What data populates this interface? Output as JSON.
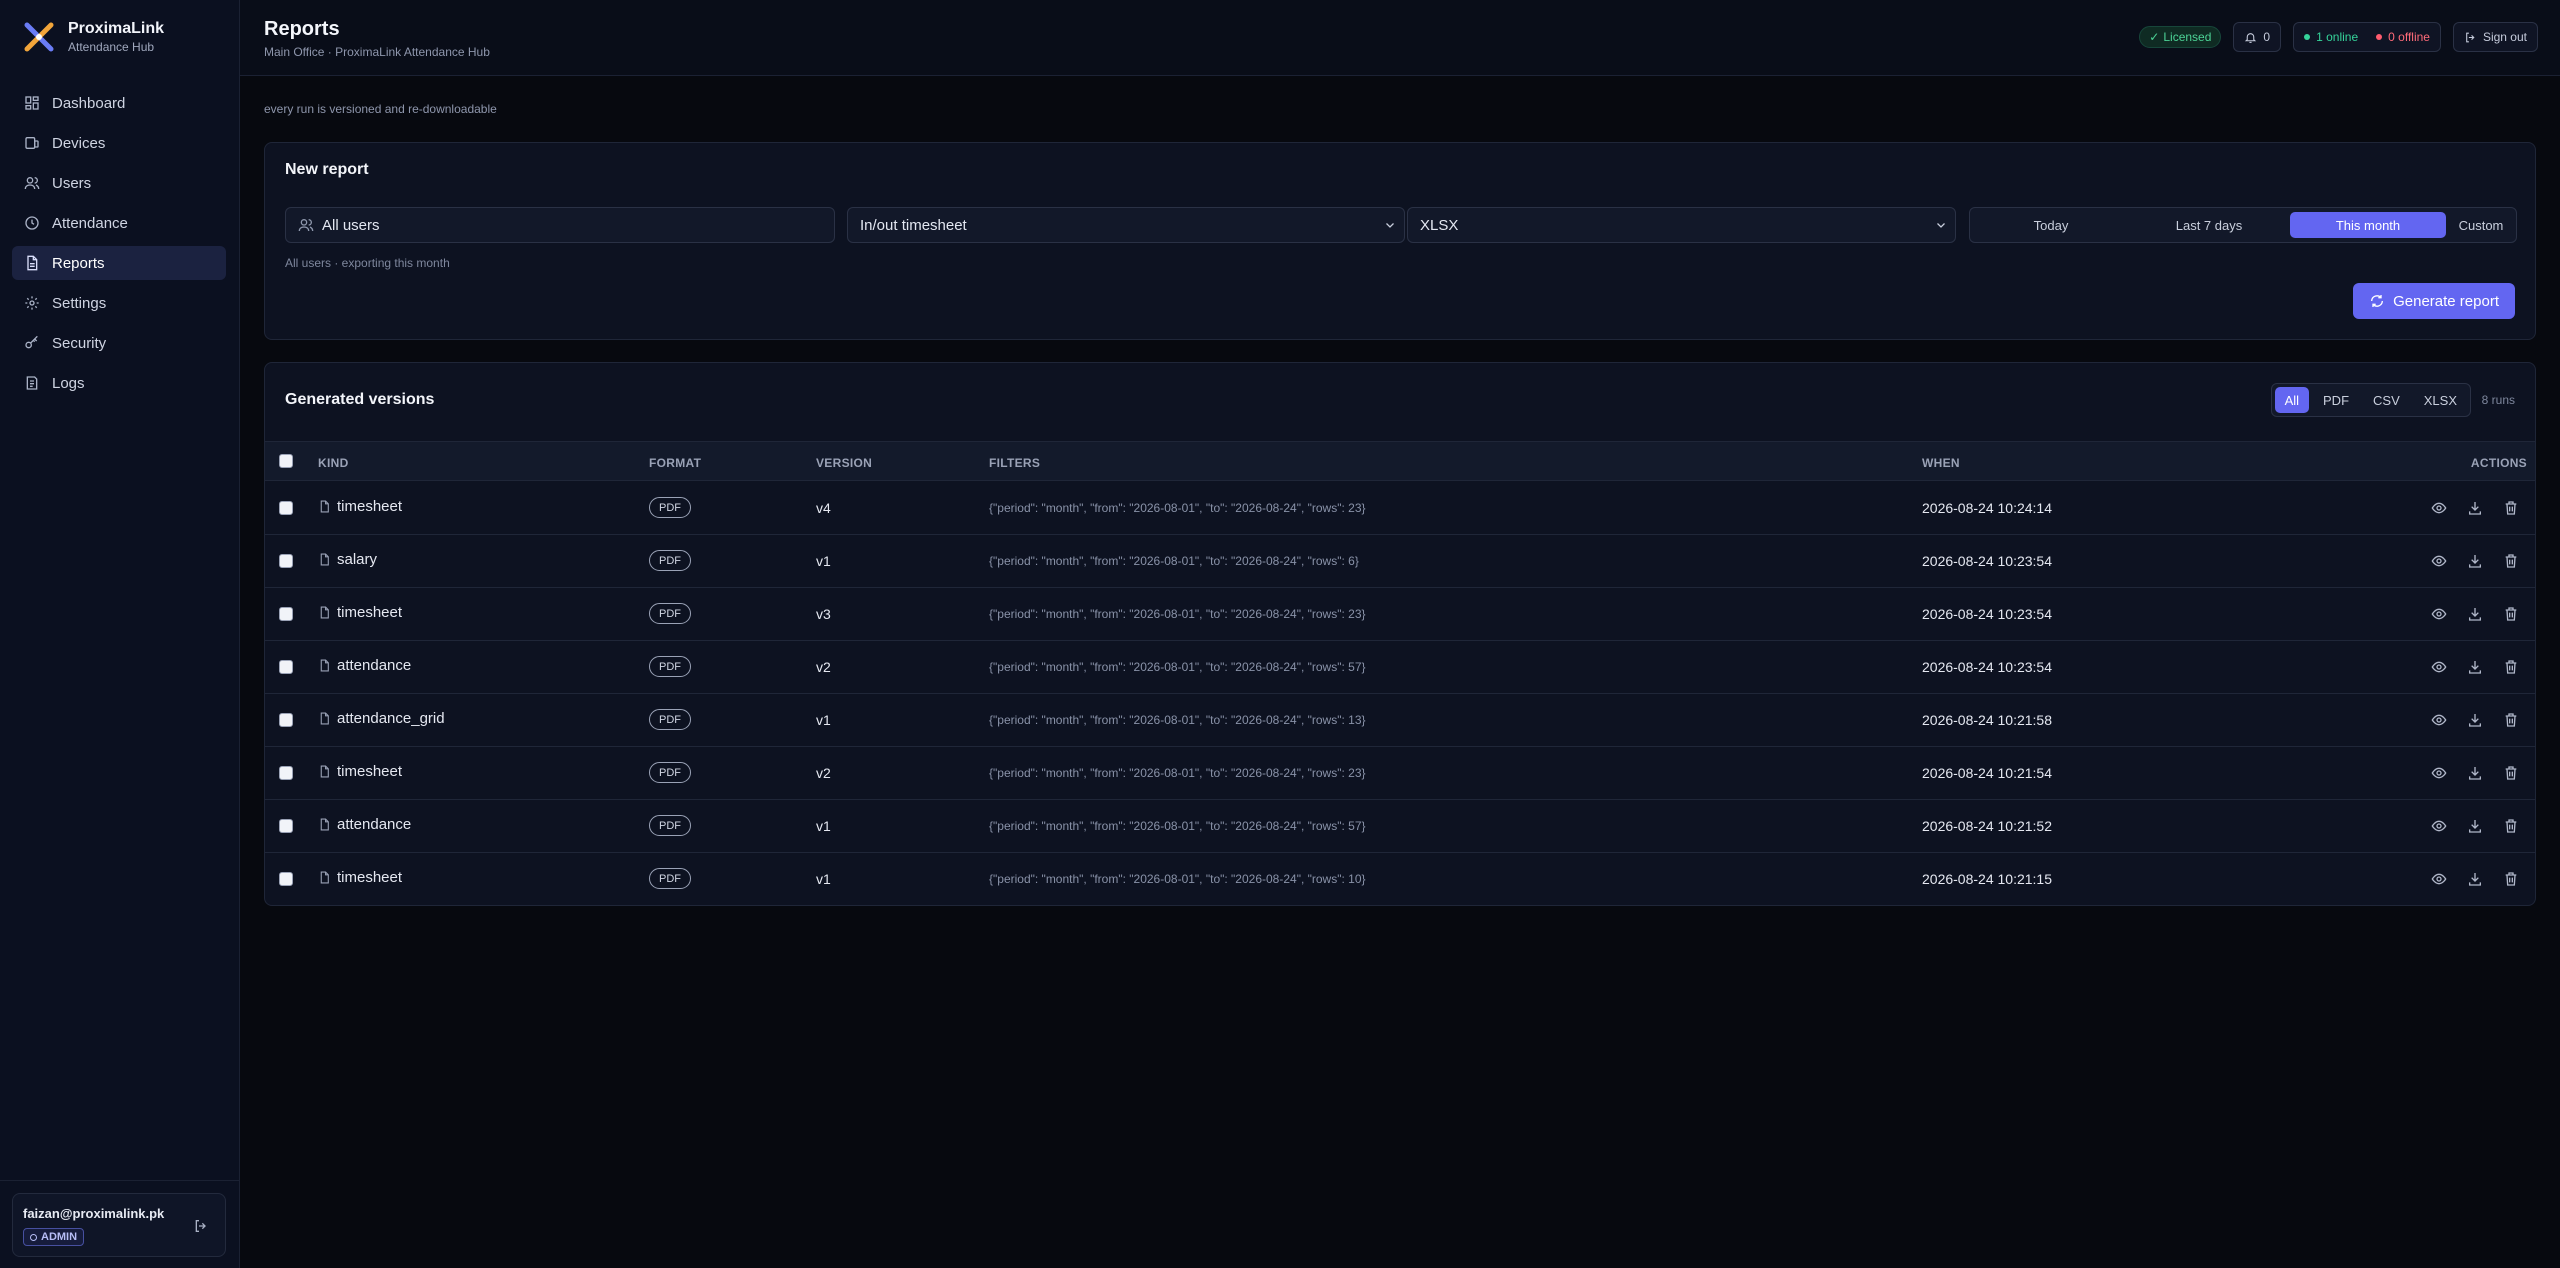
{
  "brand": {
    "name": "ProximaLink",
    "subtitle": "Attendance Hub"
  },
  "sidebar": {
    "items": [
      {
        "label": "Dashboard",
        "icon": "dashboard-icon"
      },
      {
        "label": "Devices",
        "icon": "devices-icon"
      },
      {
        "label": "Users",
        "icon": "users-icon"
      },
      {
        "label": "Attendance",
        "icon": "clock-icon"
      },
      {
        "label": "Reports",
        "icon": "report-icon",
        "active": true
      },
      {
        "label": "Settings",
        "icon": "gear-icon"
      },
      {
        "label": "Security",
        "icon": "key-icon"
      },
      {
        "label": "Logs",
        "icon": "logs-icon"
      }
    ],
    "user": {
      "email": "faizan@proximalink.pk",
      "role": "ADMIN"
    }
  },
  "header": {
    "title": "Reports",
    "subtitle": "Main Office · ProximaLink Attendance Hub",
    "licensed": "Licensed",
    "notifications": "0",
    "online": "1 online",
    "offline": "0 offline",
    "sign_out": "Sign out"
  },
  "main": {
    "note": "every run is versioned and re-downloadable",
    "new_report": {
      "title": "New report",
      "users_value": "All users",
      "report_type": "In/out timesheet",
      "format": "XLSX",
      "ranges": [
        "Today",
        "Last 7 days",
        "This month",
        "Custom"
      ],
      "active_range": "This month",
      "hint": "All users · exporting this month",
      "generate_label": "Generate report"
    },
    "versions": {
      "title": "Generated versions",
      "filters": [
        "All",
        "PDF",
        "CSV",
        "XLSX"
      ],
      "active_filter": "All",
      "runs": "8 runs",
      "columns": {
        "kind": "KIND",
        "format": "FORMAT",
        "version": "VERSION",
        "filters": "FILTERS",
        "when": "WHEN",
        "actions": "ACTIONS"
      },
      "rows": [
        {
          "kind": "timesheet",
          "format": "PDF",
          "version": "v4",
          "filters": "{\"period\": \"month\", \"from\": \"2026-08-01\", \"to\": \"2026-08-24\", \"rows\": 23}",
          "when": "2026-08-24 10:24:14"
        },
        {
          "kind": "salary",
          "format": "PDF",
          "version": "v1",
          "filters": "{\"period\": \"month\", \"from\": \"2026-08-01\", \"to\": \"2026-08-24\", \"rows\": 6}",
          "when": "2026-08-24 10:23:54"
        },
        {
          "kind": "timesheet",
          "format": "PDF",
          "version": "v3",
          "filters": "{\"period\": \"month\", \"from\": \"2026-08-01\", \"to\": \"2026-08-24\", \"rows\": 23}",
          "when": "2026-08-24 10:23:54"
        },
        {
          "kind": "attendance",
          "format": "PDF",
          "version": "v2",
          "filters": "{\"period\": \"month\", \"from\": \"2026-08-01\", \"to\": \"2026-08-24\", \"rows\": 57}",
          "when": "2026-08-24 10:23:54"
        },
        {
          "kind": "attendance_grid",
          "format": "PDF",
          "version": "v1",
          "filters": "{\"period\": \"month\", \"from\": \"2026-08-01\", \"to\": \"2026-08-24\", \"rows\": 13}",
          "when": "2026-08-24 10:21:58"
        },
        {
          "kind": "timesheet",
          "format": "PDF",
          "version": "v2",
          "filters": "{\"period\": \"month\", \"from\": \"2026-08-01\", \"to\": \"2026-08-24\", \"rows\": 23}",
          "when": "2026-08-24 10:21:54"
        },
        {
          "kind": "attendance",
          "format": "PDF",
          "version": "v1",
          "filters": "{\"period\": \"month\", \"from\": \"2026-08-01\", \"to\": \"2026-08-24\", \"rows\": 57}",
          "when": "2026-08-24 10:21:52"
        },
        {
          "kind": "timesheet",
          "format": "PDF",
          "version": "v1",
          "filters": "{\"period\": \"month\", \"from\": \"2026-08-01\", \"to\": \"2026-08-24\", \"rows\": 10}",
          "when": "2026-08-24 10:21:15"
        }
      ]
    }
  },
  "colors": {
    "accent": "#6366f1",
    "background": "#07090f",
    "sidebar": "#0b1020",
    "success": "#35d39a",
    "danger": "#ff5b6e"
  }
}
